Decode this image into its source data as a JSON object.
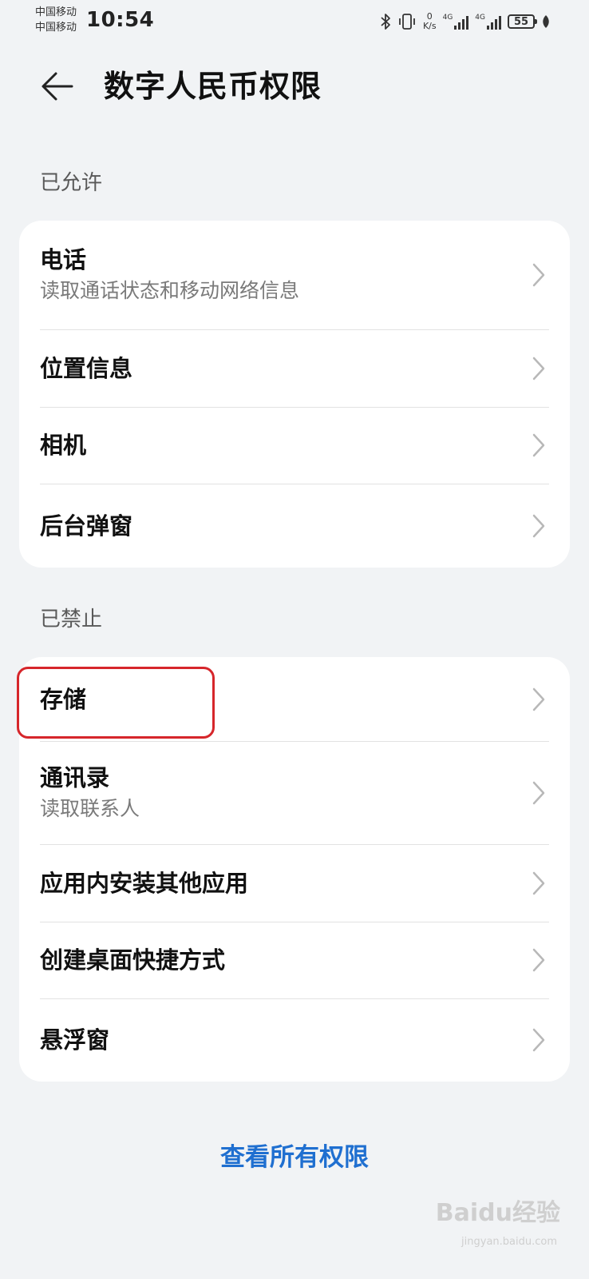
{
  "status_bar": {
    "carrier_1": "中国移动",
    "carrier_2": "中国移动",
    "time": "10:54",
    "speed_value": "0",
    "speed_unit": "K/s",
    "network_1": "4G",
    "network_2": "4G",
    "battery": "55"
  },
  "header": {
    "title": "数字人民币权限"
  },
  "allowed": {
    "label": "已允许",
    "items": [
      {
        "title": "电话",
        "subtitle": "读取通话状态和移动网络信息"
      },
      {
        "title": "位置信息"
      },
      {
        "title": "相机"
      },
      {
        "title": "后台弹窗"
      }
    ]
  },
  "denied": {
    "label": "已禁止",
    "items": [
      {
        "title": "存储"
      },
      {
        "title": "通讯录",
        "subtitle": "读取联系人"
      },
      {
        "title": "应用内安装其他应用"
      },
      {
        "title": "创建桌面快捷方式"
      },
      {
        "title": "悬浮窗"
      }
    ]
  },
  "footer": {
    "view_all_link": "查看所有权限"
  },
  "watermark": {
    "text": "Baidu经验",
    "sub": "jingyan.baidu.com"
  },
  "colors": {
    "background": "#f1f3f5",
    "card": "#ffffff",
    "link": "#1f6fd0",
    "highlight": "#d6262b"
  }
}
